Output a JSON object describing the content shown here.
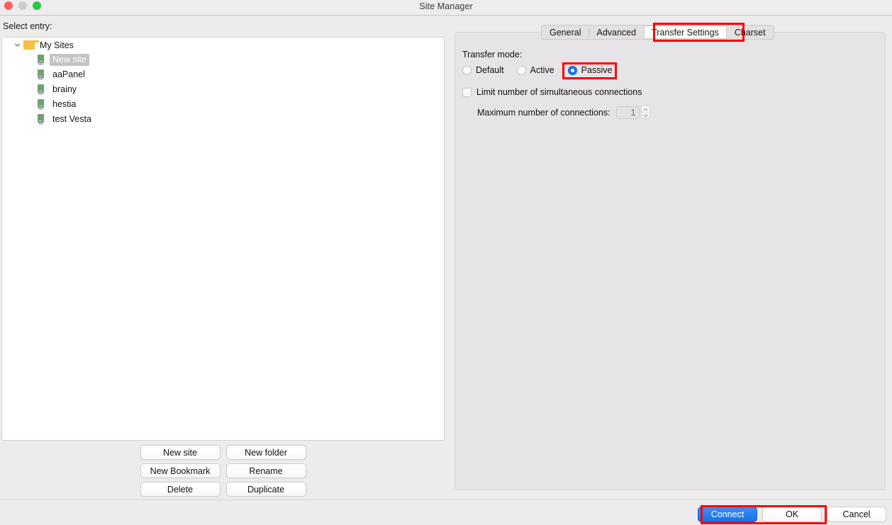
{
  "window": {
    "title": "Site Manager",
    "controls": [
      "close",
      "minimize",
      "zoom"
    ]
  },
  "left": {
    "select_entry_label": "Select entry:",
    "tree": {
      "root": {
        "label": "My Sites",
        "expanded": true
      },
      "items": [
        {
          "label": "New site",
          "selected": true
        },
        {
          "label": "aaPanel",
          "selected": false
        },
        {
          "label": "brainy",
          "selected": false
        },
        {
          "label": "hestia",
          "selected": false
        },
        {
          "label": "test Vesta",
          "selected": false
        }
      ]
    },
    "buttons": [
      {
        "label": "New site"
      },
      {
        "label": "New folder"
      },
      {
        "label": "New Bookmark"
      },
      {
        "label": "Rename"
      },
      {
        "label": "Delete"
      },
      {
        "label": "Duplicate"
      }
    ]
  },
  "right": {
    "tabs": [
      {
        "label": "General",
        "active": false
      },
      {
        "label": "Advanced",
        "active": false
      },
      {
        "label": "Transfer Settings",
        "active": true
      },
      {
        "label": "Charset",
        "active": false
      }
    ],
    "transfer_mode": {
      "label": "Transfer mode:",
      "options": [
        {
          "label": "Default",
          "selected": false
        },
        {
          "label": "Active",
          "selected": false
        },
        {
          "label": "Passive",
          "selected": true
        }
      ]
    },
    "limit_connections": {
      "label": "Limit number of simultaneous connections",
      "checked": false
    },
    "max_connections": {
      "label": "Maximum number of connections:",
      "value": "1"
    }
  },
  "footer": {
    "connect_label": "Connect",
    "ok_label": "OK",
    "cancel_label": "Cancel"
  },
  "annotations": {
    "color": "#ff0000",
    "boxes": [
      {
        "target": "Transfer Settings tab"
      },
      {
        "target": "Passive radio option"
      },
      {
        "target": "Connect and OK buttons"
      }
    ]
  }
}
